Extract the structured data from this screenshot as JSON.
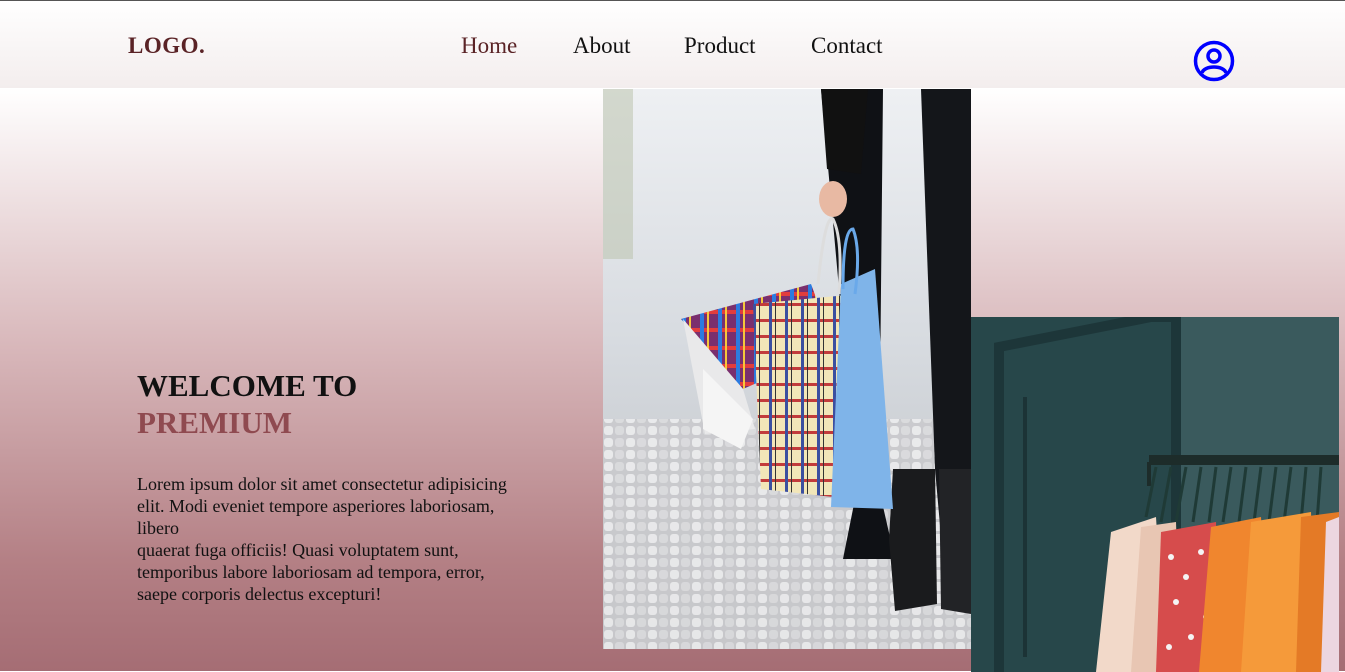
{
  "header": {
    "logo": "LOGO.",
    "nav": [
      {
        "label": "Home",
        "active": true
      },
      {
        "label": "About",
        "active": false
      },
      {
        "label": "Product",
        "active": false
      },
      {
        "label": "Contact",
        "active": false
      }
    ],
    "user_icon": "user-circle-icon"
  },
  "hero": {
    "title_line1": "WELCOME TO",
    "title_line2": "PREMIUM",
    "paragraph": [
      "Lorem ipsum dolor sit amet consectetur adipisicing",
      "elit. Modi eveniet tempore asperiores laboriosam,",
      "libero",
      "quaerat fuga officiis! Quasi voluptatem sunt,",
      "temporibus labore laboriosam ad tempora, error,",
      "saepe corporis delectus excepturi!"
    ]
  },
  "colors": {
    "accent": "#8f4a50",
    "logo": "#5a2326",
    "icon": "#0000ff"
  }
}
